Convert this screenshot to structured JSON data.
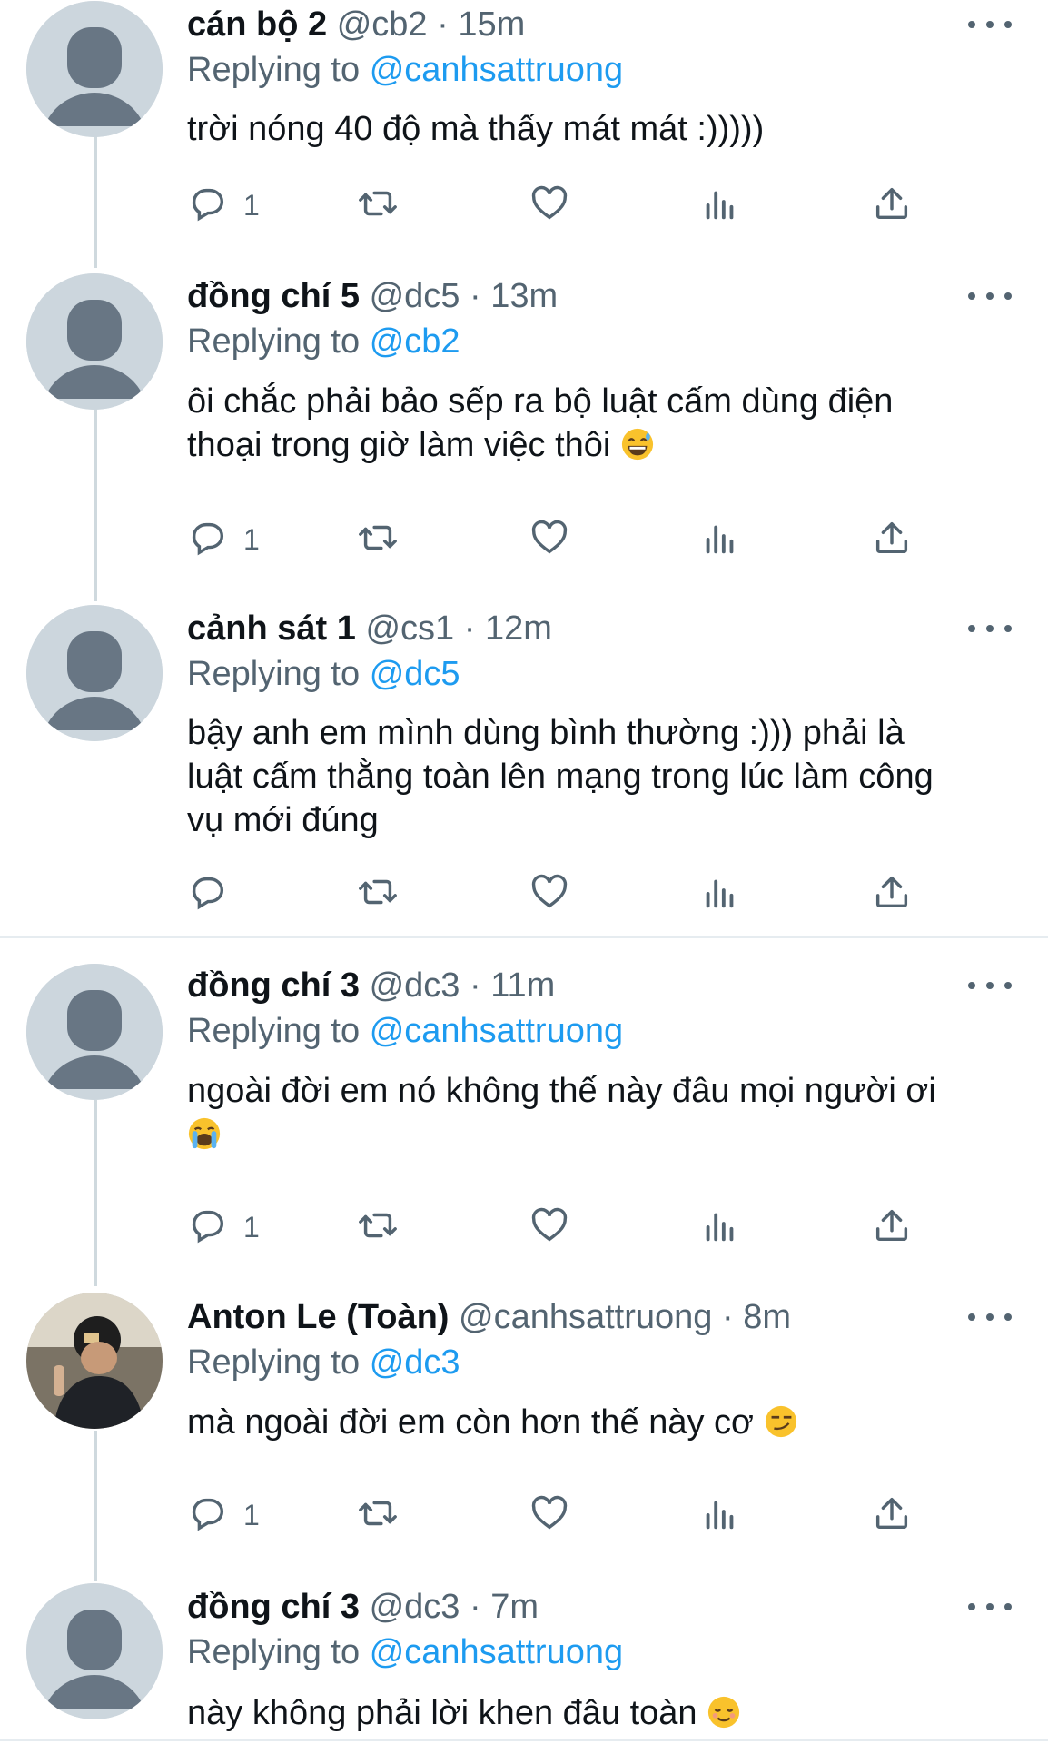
{
  "tweets": [
    {
      "name": "cán bộ 2",
      "handle": "@cb2",
      "time": "15m",
      "replying_label": "Replying to",
      "replying_to": "@canhsattruong",
      "lines": [
        "trời nóng 40 độ mà thấy mát mát :)))))"
      ],
      "emoji": "",
      "reply_count": "1",
      "avatar": "default-avatar"
    },
    {
      "name": "đồng chí 5",
      "handle": "@dc5",
      "time": "13m",
      "replying_label": "Replying to",
      "replying_to": "@cb2",
      "lines": [
        "ôi chắc phải bảo sếp ra bộ luật cấm dùng điện",
        "thoại trong giờ làm việc thôi"
      ],
      "emoji": "grinning-sweat-emoji",
      "reply_count": "1",
      "avatar": "default-avatar"
    },
    {
      "name": "cảnh sát 1",
      "handle": "@cs1",
      "time": "12m",
      "replying_label": "Replying to",
      "replying_to": "@dc5",
      "lines": [
        "bậy anh em mình dùng bình thường :))) phải là",
        "luật cấm thằng toàn lên mạng trong lúc làm công",
        "vụ mới đúng"
      ],
      "emoji": "",
      "reply_count": "",
      "avatar": "default-avatar"
    },
    {
      "name": "đồng chí 3",
      "handle": "@dc3",
      "time": "11m",
      "replying_label": "Replying to",
      "replying_to": "@canhsattruong",
      "lines": [
        "ngoài đời em nó không thế này đâu mọi người ơi",
        ""
      ],
      "emoji": "crying-emoji",
      "reply_count": "1",
      "avatar": "default-avatar"
    },
    {
      "name": "Anton Le (Toàn)",
      "handle": "@canhsattruong",
      "time": "8m",
      "replying_label": "Replying to",
      "replying_to": "@dc3",
      "lines": [
        "mà ngoài đời em còn hơn thế này cơ"
      ],
      "emoji": "smirk-emoji",
      "reply_count": "1",
      "avatar": "photo-avatar"
    },
    {
      "name": "đồng chí 3",
      "handle": "@dc3",
      "time": "7m",
      "replying_label": "Replying to",
      "replying_to": "@canhsattruong",
      "lines": [
        "này không phải lời khen đâu toàn"
      ],
      "emoji": "relieved-emoji",
      "reply_count": "",
      "avatar": "default-avatar"
    }
  ],
  "dot_separator": "·",
  "colors": {
    "link": "#1d9bf0",
    "secondary": "#536471",
    "avatar_bg": "#ccd6dd",
    "avatar_fg": "#687684",
    "divider": "#e6ecf0"
  },
  "icons": [
    "reply-icon",
    "retweet-icon",
    "like-icon",
    "analytics-icon",
    "share-icon",
    "more-icon"
  ]
}
